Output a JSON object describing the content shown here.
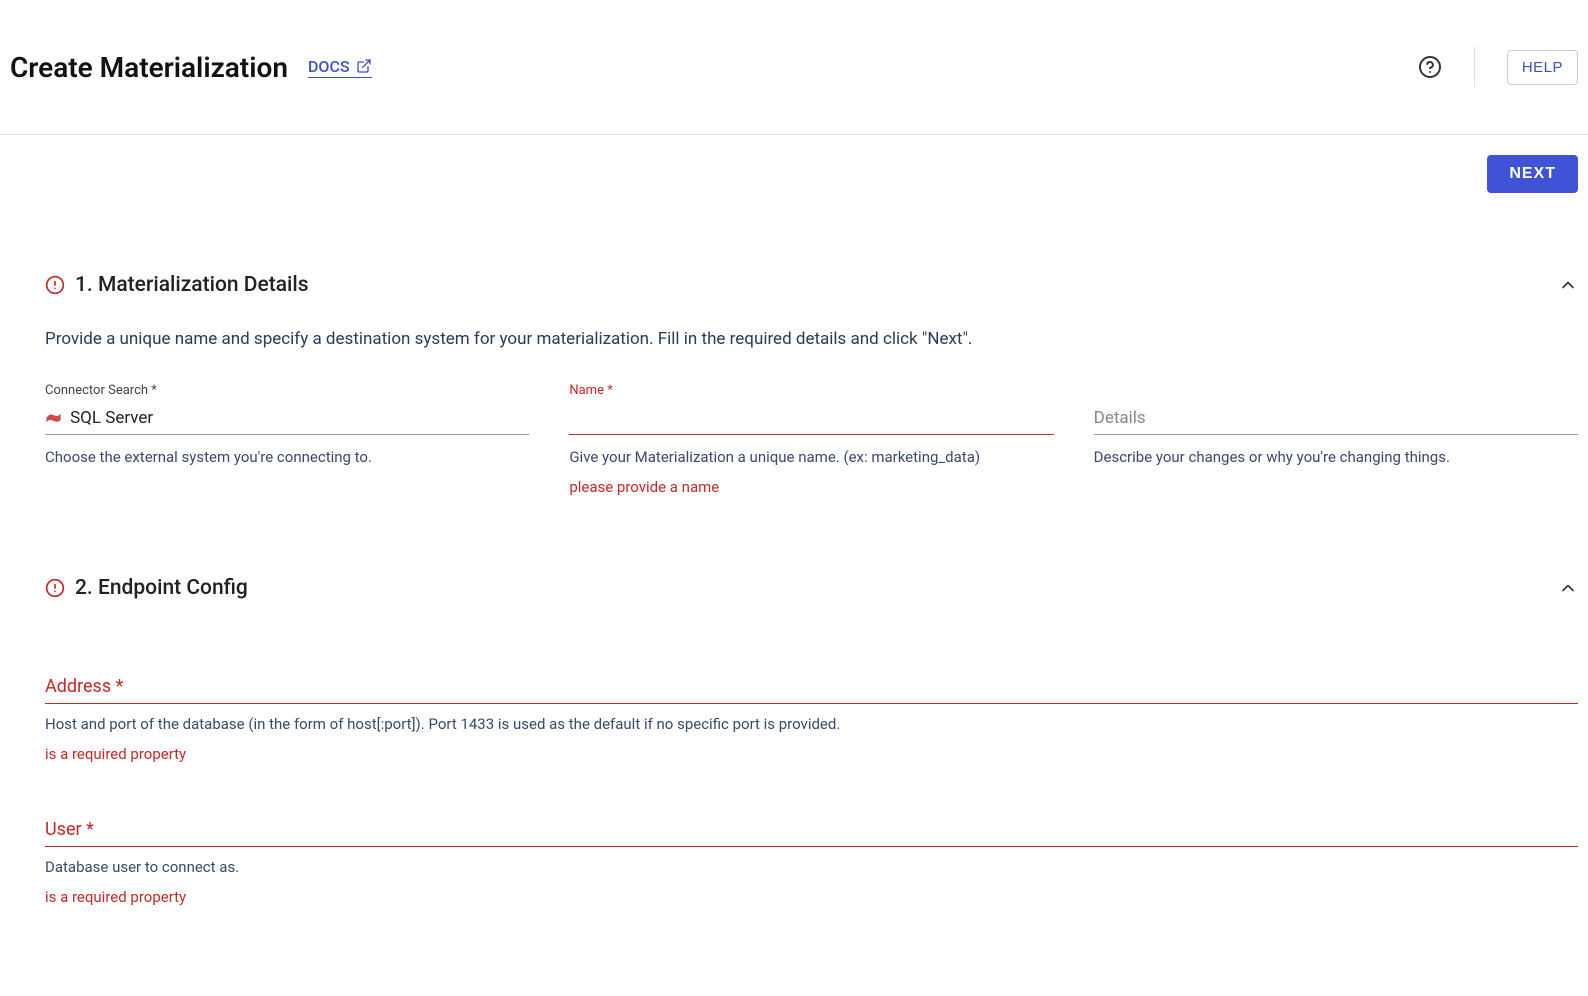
{
  "header": {
    "title": "Create Materialization",
    "docs_label": "DOCS",
    "help_button": "HELP"
  },
  "actions": {
    "next_label": "NEXT"
  },
  "section1": {
    "title": "1. Materialization Details",
    "description": "Provide a unique name and specify a destination system for your materialization. Fill in the required details and click \"Next\".",
    "fields": {
      "connector": {
        "label": "Connector Search *",
        "value": "SQL Server",
        "helper": "Choose the external system you're connecting to."
      },
      "name": {
        "label": "Name *",
        "value": "",
        "helper": "Give your Materialization a unique name. (ex: marketing_data)",
        "error": "please provide a name"
      },
      "details": {
        "placeholder": "Details",
        "value": "",
        "helper": "Describe your changes or why you're changing things."
      }
    }
  },
  "section2": {
    "title": "2. Endpoint Config",
    "fields": {
      "address": {
        "placeholder": "Address *",
        "helper": "Host and port of the database (in the form of host[:port]). Port 1433 is used as the default if no specific port is provided.",
        "error": "is a required property"
      },
      "user": {
        "placeholder": "User *",
        "helper": "Database user to connect as.",
        "error": "is a required property"
      }
    }
  }
}
